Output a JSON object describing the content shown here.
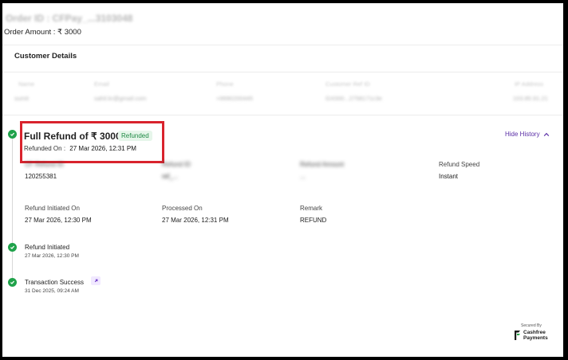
{
  "order": {
    "id_text": "Order ID : CFPay_...3103048",
    "amount_label": "Order Amount : ₹ 3000"
  },
  "customer_details": {
    "title": "Customer Details",
    "headers": [
      "Name",
      "Email",
      "Phone",
      "Customer Ref ID",
      "IP Address"
    ],
    "values": [
      "sumit",
      "sahil.kr@gmail.com",
      "+9990200445",
      "GX000...2758171c3e",
      "103.85.91.21"
    ]
  },
  "refund": {
    "title": "Full Refund of ₹ 3000",
    "status": "Refunded",
    "refunded_on_label": "Refunded On :",
    "refunded_on_value": "27 Mar 2026, 12:31 PM",
    "hide_history_label": "Hide History",
    "fields": [
      {
        "label": "CF Refund ID",
        "value": "120255381"
      },
      {
        "label": "Refund ID",
        "value": "ref_..."
      },
      {
        "label": "Refund Amount",
        "value": "..."
      },
      {
        "label": "Refund Speed",
        "value": "Instant"
      },
      {
        "label": "Refund Initiated On",
        "value": "27 Mar 2026, 12:30 PM"
      },
      {
        "label": "Processed On",
        "value": "27 Mar 2026, 12:31 PM"
      },
      {
        "label": "Remark",
        "value": "REFUND"
      }
    ]
  },
  "timeline": [
    {
      "title": "Refund Initiated",
      "date": "27 Mar 2026, 12:30 PM"
    },
    {
      "title": "Transaction Success",
      "date": "31 Dec 2025, 09:24 AM"
    }
  ],
  "footer": {
    "secured_by": "Secured By",
    "brand_line1": "Cashfree",
    "brand_line2": "Payments"
  },
  "colors": {
    "success": "#1fa24a",
    "accent": "#5a2ea6",
    "highlight": "#d9232d"
  }
}
